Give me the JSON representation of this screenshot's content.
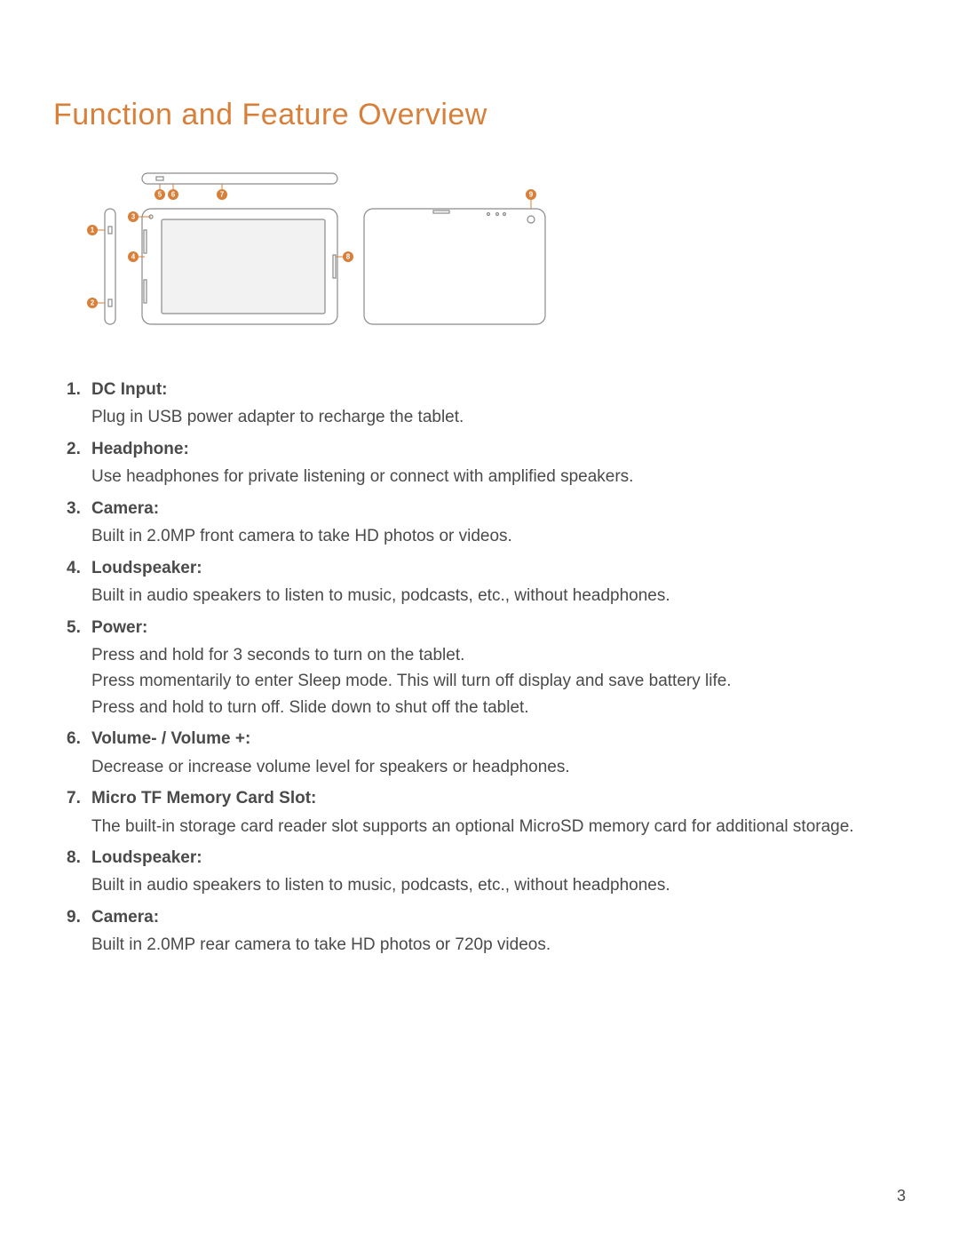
{
  "title": "Function and Feature Overview",
  "callouts": [
    "1",
    "2",
    "3",
    "4",
    "5",
    "6",
    "7",
    "8",
    "9"
  ],
  "features": [
    {
      "num": "1.",
      "name": "DC Input:",
      "desc": "Plug in USB power adapter to recharge the tablet."
    },
    {
      "num": "2.",
      "name": "Headphone:",
      "desc": "Use headphones for private listening or connect with amplified speakers."
    },
    {
      "num": "3.",
      "name": "Camera:",
      "desc": "Built in 2.0MP front camera to take HD photos or videos."
    },
    {
      "num": "4.",
      "name": "Loudspeaker:",
      "desc": "Built in audio speakers to listen to music, podcasts, etc., without headphones."
    },
    {
      "num": "5.",
      "name": "Power:",
      "desc": "Press and hold for 3 seconds to turn on the tablet.\nPress momentarily to enter Sleep mode. This will turn off display and save battery life.\nPress and hold to turn off. Slide down to shut off the tablet."
    },
    {
      "num": "6.",
      "name": "Volume- / Volume +:",
      "desc": "Decrease or increase volume level for speakers or headphones."
    },
    {
      "num": "7.",
      "name": "Micro TF Memory Card Slot:",
      "desc": "The built-in storage card reader slot supports an optional MicroSD memory card for additional storage."
    },
    {
      "num": "8.",
      "name": "Loudspeaker:",
      "desc": "Built in audio speakers to listen to music, podcasts, etc., without headphones."
    },
    {
      "num": "9.",
      "name": "Camera:",
      "desc": "Built in 2.0MP rear camera to take HD photos or 720p videos."
    }
  ],
  "page_number": "3"
}
